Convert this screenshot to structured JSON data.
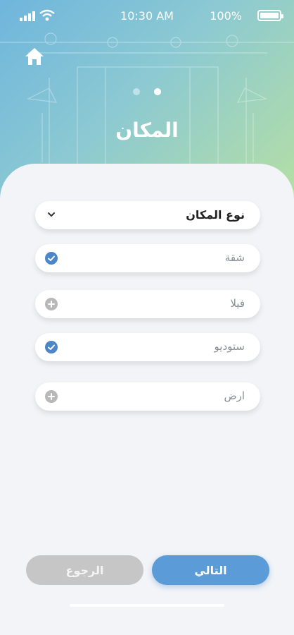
{
  "status_bar": {
    "time": "10:30 AM",
    "battery": "100%"
  },
  "header": {
    "title": "المكان",
    "pager": {
      "total": 2,
      "active_index": 0
    }
  },
  "form": {
    "select": {
      "label": "نوع المكان"
    },
    "options": [
      {
        "label": "شقة",
        "state": "checked"
      },
      {
        "label": "فيلا",
        "state": "add"
      },
      {
        "label": "ستوديو",
        "state": "checked"
      },
      {
        "label": "ارض",
        "state": "add"
      }
    ]
  },
  "buttons": {
    "next_label": "التالي",
    "back_label": "الرجوع"
  },
  "colors": {
    "accent": "#5b9cd8",
    "check": "#4a86c8",
    "add": "#b8b8b8",
    "back": "#c6c6c6"
  }
}
